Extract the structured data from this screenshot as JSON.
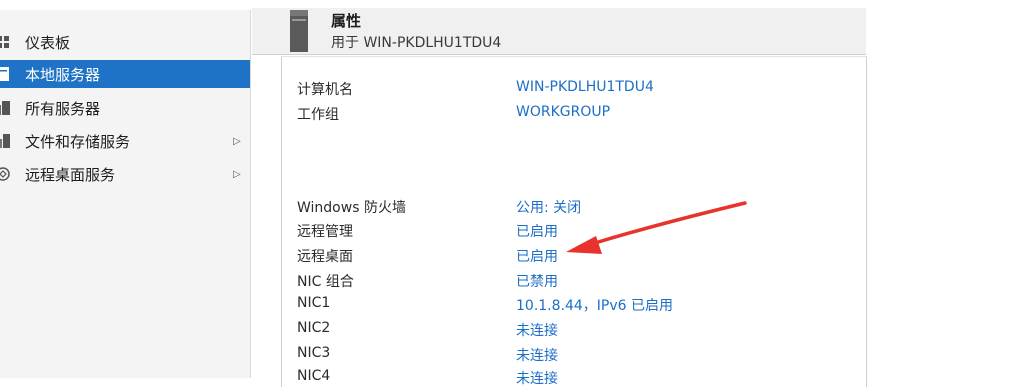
{
  "sidebar": {
    "items": [
      {
        "label": "仪表板",
        "icon": "dashboard-icon",
        "selected": false,
        "has_arrow": false
      },
      {
        "label": "本地服务器",
        "icon": "server-icon",
        "selected": true,
        "has_arrow": false
      },
      {
        "label": "所有服务器",
        "icon": "servers-icon",
        "selected": false,
        "has_arrow": false
      },
      {
        "label": "文件和存储服务",
        "icon": "storage-icon",
        "selected": false,
        "has_arrow": true
      },
      {
        "label": "远程桌面服务",
        "icon": "remote-desktop-icon",
        "selected": false,
        "has_arrow": true
      }
    ],
    "arrow_glyph": "▷"
  },
  "header": {
    "title": "属性",
    "subtitle": "用于 WIN-PKDLHU1TDU4"
  },
  "properties": [
    {
      "name": "计算机名",
      "value": "WIN-PKDLHU1TDU4"
    },
    {
      "name": "工作组",
      "value": "WORKGROUP"
    },
    {
      "name": "Windows 防火墙",
      "value": "公用: 关闭"
    },
    {
      "name": "远程管理",
      "value": "已启用"
    },
    {
      "name": "远程桌面",
      "value": "已启用"
    },
    {
      "name": "NIC 组合",
      "value": "已禁用"
    },
    {
      "name": "NIC1",
      "value": "10.1.8.44，IPv6 已启用"
    },
    {
      "name": "NIC2",
      "value": "未连接"
    },
    {
      "name": "NIC3",
      "value": "未连接"
    },
    {
      "name": "NIC4",
      "value": "未连接"
    }
  ],
  "colors": {
    "accent": "#1e73c6",
    "link": "#1c6ec7",
    "annotation_arrow": "#e8322c"
  }
}
